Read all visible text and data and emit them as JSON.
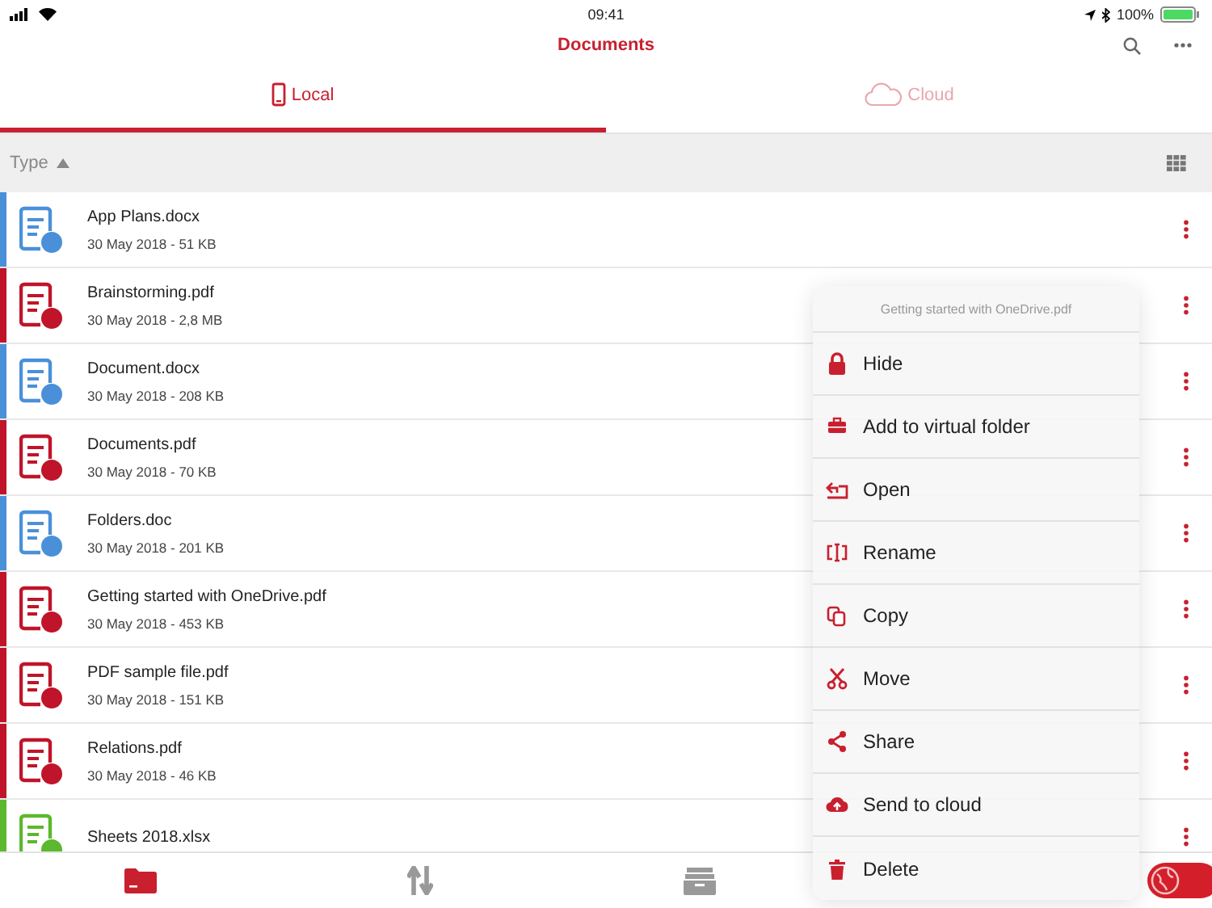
{
  "status_bar": {
    "time": "09:41",
    "battery": "100%"
  },
  "nav_bar": {
    "title": "Documents"
  },
  "tabs": [
    {
      "label": "Local",
      "kind": "phone",
      "selected": true
    },
    {
      "label": "Cloud",
      "kind": "cloud",
      "selected": false
    }
  ],
  "sort_bar": {
    "label": "Type"
  },
  "files": [
    {
      "name": "App Plans.docx",
      "meta": "30 May 2018 - 51 KB",
      "color": "#4a90d9"
    },
    {
      "name": "Brainstorming.pdf",
      "meta": "30 May 2018 - 2,8 MB",
      "color": "#c0142a"
    },
    {
      "name": "Document.docx",
      "meta": "30 May 2018 - 208 KB",
      "color": "#4a90d9"
    },
    {
      "name": "Documents.pdf",
      "meta": "30 May 2018 - 70 KB",
      "color": "#c0142a"
    },
    {
      "name": "Folders.doc",
      "meta": "30 May 2018 - 201 KB",
      "color": "#4a90d9"
    },
    {
      "name": "Getting started with OneDrive.pdf",
      "meta": "30 May 2018 - 453 KB",
      "color": "#c0142a"
    },
    {
      "name": "PDF sample file.pdf",
      "meta": "30 May 2018 - 151 KB",
      "color": "#c0142a"
    },
    {
      "name": "Relations.pdf",
      "meta": "30 May 2018 - 46 KB",
      "color": "#c0142a"
    },
    {
      "name": "Sheets 2018.xlsx",
      "color": "#5cb82e"
    }
  ],
  "context_menu": {
    "title": "Getting started with OneDrive.pdf",
    "items": [
      {
        "label": "Hide",
        "kind": "lock"
      },
      {
        "label": "Add to virtual folder",
        "kind": "briefcase"
      },
      {
        "label": "Open",
        "kind": "open"
      },
      {
        "label": "Rename",
        "kind": "rename"
      },
      {
        "label": "Copy",
        "kind": "copy"
      },
      {
        "label": "Move",
        "kind": "move"
      },
      {
        "label": "Share",
        "kind": "share"
      },
      {
        "label": "Send to cloud",
        "kind": "cloud"
      },
      {
        "label": "Delete",
        "kind": "trash"
      }
    ]
  },
  "tab_bar": [
    {
      "kind": "folder",
      "selected": true
    },
    {
      "kind": "transfer",
      "selected": false
    },
    {
      "kind": "archive",
      "selected": false
    }
  ]
}
